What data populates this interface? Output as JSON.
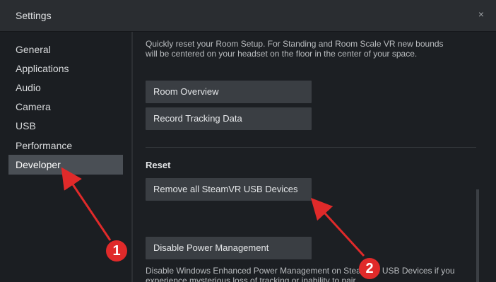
{
  "window": {
    "title": "Settings",
    "close_glyph": "×"
  },
  "sidebar": {
    "items": [
      {
        "label": "General"
      },
      {
        "label": "Applications"
      },
      {
        "label": "Audio"
      },
      {
        "label": "Camera"
      },
      {
        "label": "USB"
      },
      {
        "label": "Performance"
      },
      {
        "label": "Developer",
        "active": true
      }
    ]
  },
  "content": {
    "room_desc": "Quickly reset your Room Setup. For Standing and Room Scale VR new bounds will be centered on your headset on the floor in the center of your space.",
    "room_overview_label": "Room Overview",
    "record_tracking_label": "Record Tracking Data",
    "reset_section_label": "Reset",
    "remove_usb_label": "Remove all SteamVR USB Devices",
    "disable_power_label": "Disable Power Management",
    "power_desc": "Disable Windows Enhanced Power Management on SteamVR USB Devices if you experience mysterious loss of tracking or inability to pair"
  },
  "annotations": {
    "badge_1": "1",
    "badge_2": "2",
    "color": "#e02a2a"
  },
  "colors": {
    "background": "#1b1e22",
    "titlebar": "#2a2d31",
    "button": "#3a3e43",
    "active_item": "#4a4f55"
  }
}
